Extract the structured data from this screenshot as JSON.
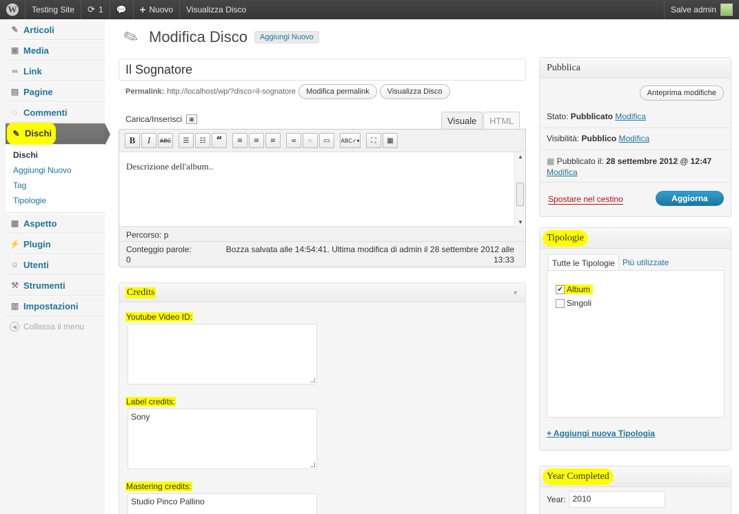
{
  "admin_bar": {
    "site_name": "Testing Site",
    "updates_count": "1",
    "new_label": "Nuovo",
    "view_label": "Visualizza Disco",
    "greeting": "Salve admin"
  },
  "menu": {
    "items_top": [
      {
        "label": "Articoli",
        "icon": "pin-icon"
      },
      {
        "label": "Media",
        "icon": "media-icon"
      },
      {
        "label": "Link",
        "icon": "link-icon"
      },
      {
        "label": "Pagine",
        "icon": "page-icon"
      },
      {
        "label": "Commenti",
        "icon": "comment-icon"
      }
    ],
    "active": {
      "label": "Dischi",
      "icon": "pin-icon"
    },
    "submenu": [
      "Dischi",
      "Aggiungi Nuovo",
      "Tag",
      "Tipologie"
    ],
    "items_bottom": [
      {
        "label": "Aspetto",
        "icon": "appearance-icon"
      },
      {
        "label": "Plugin",
        "icon": "plugin-icon"
      },
      {
        "label": "Utenti",
        "icon": "users-icon"
      },
      {
        "label": "Strumenti",
        "icon": "tools-icon"
      },
      {
        "label": "Impostazioni",
        "icon": "settings-icon"
      }
    ],
    "collapse_label": "Collassa il menu"
  },
  "header": {
    "title": "Modifica Disco",
    "add_new": "Aggiungi Nuovo"
  },
  "post": {
    "title": "Il Sognatore",
    "permalink_label": "Permalink:",
    "permalink_url": "http://localhost/wp/?disco=il-sognatore",
    "edit_permalink": "Modifica permalink",
    "view_post": "Visualizza Disco"
  },
  "editor": {
    "upload_label": "Carica/Inserisci",
    "tab_visual": "Visuale",
    "tab_html": "HTML",
    "content": "Descrizione dell'album..",
    "path_label": "Percorso:",
    "path_value": "p",
    "wordcount_label": "Conteggio parole:",
    "wordcount_value": "0",
    "autosave": "Bozza salvata alle 14:54:41. Ultima modifica di admin il 28 settembre 2012 alle 13:33"
  },
  "credits": {
    "title": "Credits",
    "youtube_label": "Youtube Video ID:",
    "youtube_value": "",
    "label_label": "Label credits:",
    "label_value": "Sony",
    "mastering_label": "Mastering credits:",
    "mastering_value": "Studio Pinco Pallino"
  },
  "publish": {
    "title": "Pubblica",
    "preview": "Anteprima modifiche",
    "status_label": "Stato:",
    "status_value": "Pubblicato",
    "visibility_label": "Visibilità:",
    "visibility_value": "Pubblico",
    "edit_link": "Modifica",
    "published_label": "Pubblicato il:",
    "published_value": "28 settembre 2012 @ 12:47",
    "trash": "Spostare nel cestino",
    "update": "Aggiorna"
  },
  "tipologie": {
    "title": "Tipologie",
    "tab_all": "Tutte le Tipologie",
    "tab_popular": "Più utilizzate",
    "categories": [
      {
        "label": "Album",
        "checked": true
      },
      {
        "label": "Singoli",
        "checked": false
      }
    ],
    "add_new": "+ Aggiungi nuova Tipologia"
  },
  "year": {
    "title": "Year Completed",
    "label": "Year:",
    "value": "2010"
  },
  "colors": {
    "highlight": "#ffff00",
    "link": "#21759b",
    "primary_button": "#21759b",
    "trash": "#bc0b0b"
  }
}
